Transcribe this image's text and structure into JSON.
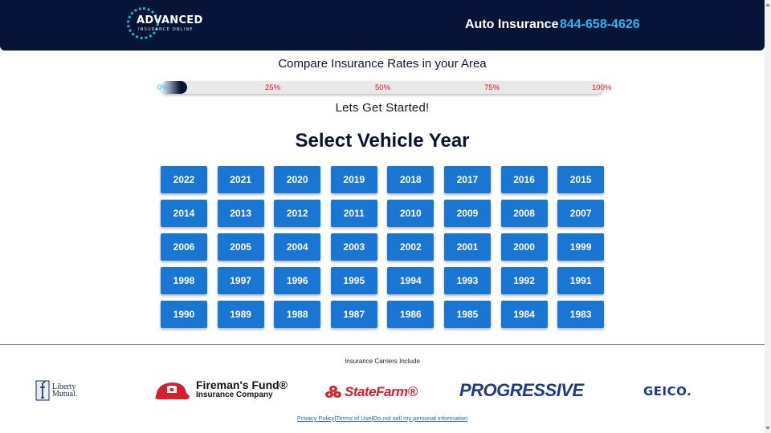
{
  "header": {
    "logo_main": "ADVANCED",
    "logo_sub": "INSURANCE ONLINE",
    "title": "Auto Insurance",
    "phone": "844-658-4626"
  },
  "form": {
    "subtitle": "Compare Insurance Rates in your Area",
    "progress_percent": 0,
    "progress_ticks": [
      "0%",
      "25%",
      "50%",
      "75%",
      "100%"
    ],
    "status": "Lets Get Started!",
    "heading": "Select Vehicle Year",
    "years": [
      "2022",
      "2021",
      "2020",
      "2019",
      "2018",
      "2017",
      "2016",
      "2015",
      "2014",
      "2013",
      "2012",
      "2011",
      "2010",
      "2009",
      "2008",
      "2007",
      "2006",
      "2005",
      "2004",
      "2003",
      "2002",
      "2001",
      "2000",
      "1999",
      "1998",
      "1997",
      "1996",
      "1995",
      "1994",
      "1993",
      "1992",
      "1991",
      "1990",
      "1989",
      "1988",
      "1987",
      "1986",
      "1985",
      "1984",
      "1983"
    ]
  },
  "carriers": {
    "label": "Insurance Carriers Include",
    "liberty_line1": "Liberty",
    "liberty_line2": "Mutual.",
    "firemans_title": "Fireman's Fund®",
    "firemans_sub": "Insurance Company",
    "statefarm": "StateFarm®",
    "progressive": "PROGRESSIVE",
    "geico": "GEICO."
  },
  "footer": {
    "privacy": "Privacy Policy",
    "terms": "Terms of Use",
    "do_not_sell": "Do not sell my personal information",
    "separator": "|"
  },
  "colors": {
    "header_bg": "#061537",
    "phone": "#2fb6f0",
    "button": "#1976d2",
    "tick": "#e0102a"
  }
}
